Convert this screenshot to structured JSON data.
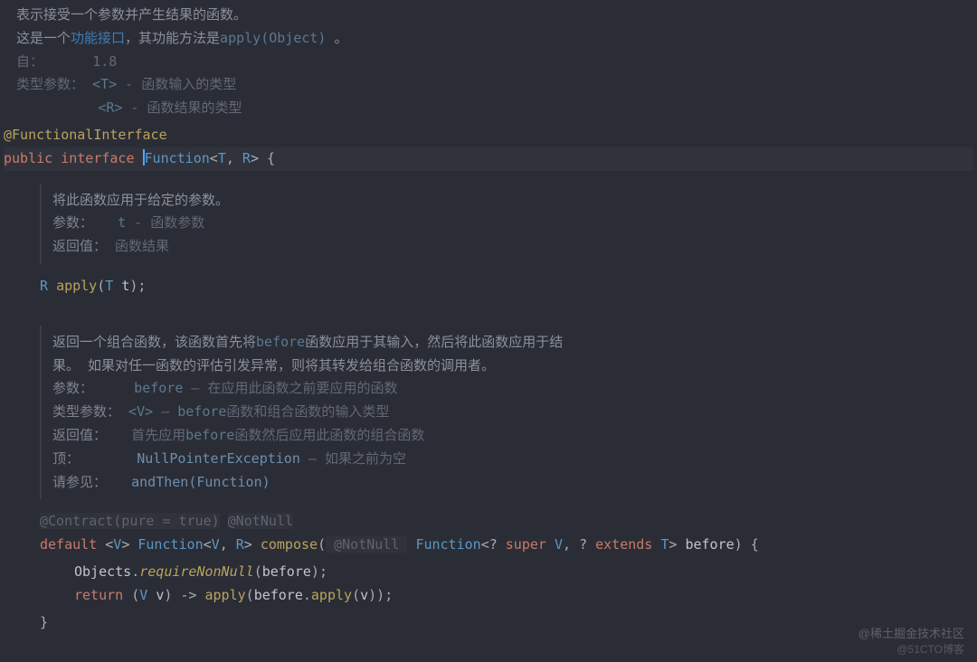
{
  "doc": {
    "head1": "表示接受一个参数并产生结果的函数。",
    "head2_a": "这是一个",
    "head2_link": "功能接口",
    "head2_b": "，其功能方法是",
    "head2_code": "apply(Object)",
    "head2_c": " 。",
    "since_label": "自：",
    "since_value": "1.8",
    "typeparams_label": "类型参数：",
    "tp_T_code": "<T>",
    "tp_T_desc": " - 函数输入的类型",
    "tp_R_code": "<R>",
    "tp_R_desc": " - 函数结果的类型"
  },
  "code": {
    "annotation": "@FunctionalInterface",
    "kw_public": "public",
    "kw_interface": "interface",
    "type_function": "Function",
    "generic_open": "<",
    "t_t": "T",
    "comma": ", ",
    "t_r": "R",
    "generic_close": ">",
    "brace_open": " {"
  },
  "apply_doc": {
    "line1": "将此函数应用于给定的参数。",
    "params_label": "参数：",
    "param_code": "t",
    "param_desc": " - 函数参数",
    "return_label": "返回值：",
    "return_desc": "函数结果"
  },
  "apply_sig": {
    "ret": "R ",
    "name": "apply",
    "paren_open": "(",
    "ptype": "T ",
    "pname": "t",
    "paren_close": ")",
    "semi": ";"
  },
  "compose_doc": {
    "line1a": "返回一个组合函数，该函数首先将",
    "line1_code": "before",
    "line1b": "函数应用于其输入，然后将此函数应用于结",
    "line2": "果。 如果对任一函数的评估引发异常，则将其转发给组合函数的调用者。",
    "params_label": "参数：",
    "params_code": "before",
    "params_desc": " – 在应用此函数之前要应用的函数",
    "typeparams_label": "类型参数：",
    "tp_code": "<V>",
    "tp_desc_a": " – ",
    "tp_desc_code": "before",
    "tp_desc_b": "函数和组合函数的输入类型",
    "return_label": "返回值：",
    "return_desc_a": "首先应用",
    "return_desc_code": "before",
    "return_desc_b": "函数然后应用此函数的组合函数",
    "throws_label": "顶：",
    "throws_code": "NullPointerException",
    "throws_desc": " – 如果之前为空",
    "see_label": "请参见：",
    "see_link": "andThen(Function)"
  },
  "compose_sig": {
    "contract": "@Contract(pure = true)",
    "notnull": "@NotNull",
    "kw_default": "default",
    "gen": "<V>",
    "ret_type": "Function",
    "ret_gen_open": "<",
    "ret_v": "V",
    "ret_comma": ", ",
    "ret_r": "R",
    "ret_gen_close": ">",
    "name": "compose",
    "paren_open": "(",
    "p_notnull": " @NotNull ",
    "ptype": "Function",
    "pgen_open": "<",
    "wild1": "? ",
    "kw_super": "super",
    "p_v": " V",
    "p_comma": ", ",
    "wild2": "? ",
    "kw_extends": "extends",
    "p_t": " T",
    "pgen_close": ">",
    "pname": " before",
    "paren_close": ")",
    "brace_open": " {",
    "body1_obj": "Objects",
    "body1_dot": ".",
    "body1_m": "requireNonNull",
    "body1_po": "(",
    "body1_arg": "before",
    "body1_pc": ")",
    "body1_semi": ";",
    "kw_return": "return",
    "lam_open": " (",
    "lam_ptype": "V ",
    "lam_pname": "v",
    "lam_close": ") ",
    "arrow": "-> ",
    "call1": "apply",
    "po2": "(",
    "arg_before": "before",
    "dot": ".",
    "call2": "apply",
    "po3": "(",
    "arg_v": "v",
    "pc3": ")",
    "pc2": ")",
    "semi2": ";",
    "brace_close": "}"
  },
  "watermark": {
    "line1": "@稀土掘金技术社区",
    "line2": "@51CTO博客"
  }
}
